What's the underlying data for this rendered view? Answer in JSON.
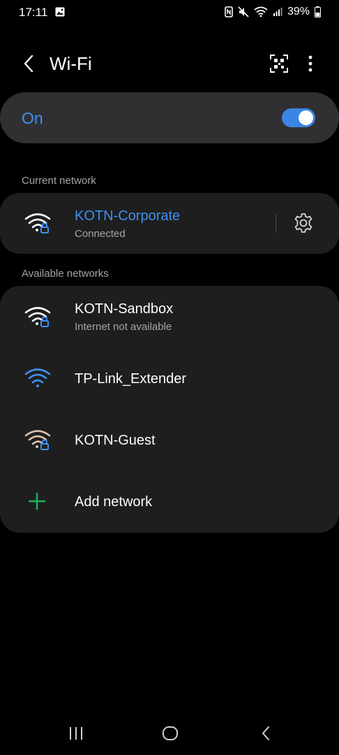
{
  "status_bar": {
    "time": "17:11",
    "battery_percent": "39%",
    "icons": [
      "gallery-icon",
      "nfc-icon",
      "mute-icon",
      "wifi-signal-icon",
      "cell-signal-icon",
      "battery-icon"
    ]
  },
  "app_bar": {
    "title": "Wi-Fi",
    "back_icon": "back-arrow-icon",
    "qr_icon": "qr-scan-icon",
    "more_icon": "more-vertical-icon"
  },
  "wifi_toggle": {
    "label": "On",
    "enabled": true,
    "accent_color": "#3e91ef"
  },
  "current_network": {
    "section_label": "Current network",
    "name": "KOTN-Corporate",
    "status": "Connected",
    "secured": true,
    "settings_icon": "gear-icon"
  },
  "available_networks": {
    "section_label": "Available networks",
    "items": [
      {
        "name": "KOTN-Sandbox",
        "status": "Internet not available",
        "secured": true,
        "icon": "wifi-lock-icon"
      },
      {
        "name": "TP-Link_Extender",
        "status": "",
        "secured": false,
        "icon": "wifi-icon"
      },
      {
        "name": "KOTN-Guest",
        "status": "",
        "secured": true,
        "icon": "wifi-lock-icon"
      }
    ],
    "add_network": {
      "label": "Add network",
      "icon": "plus-icon",
      "icon_color": "#21b35c"
    }
  },
  "nav_bar": {
    "icons": [
      "recents-icon",
      "home-icon",
      "back-icon"
    ]
  }
}
